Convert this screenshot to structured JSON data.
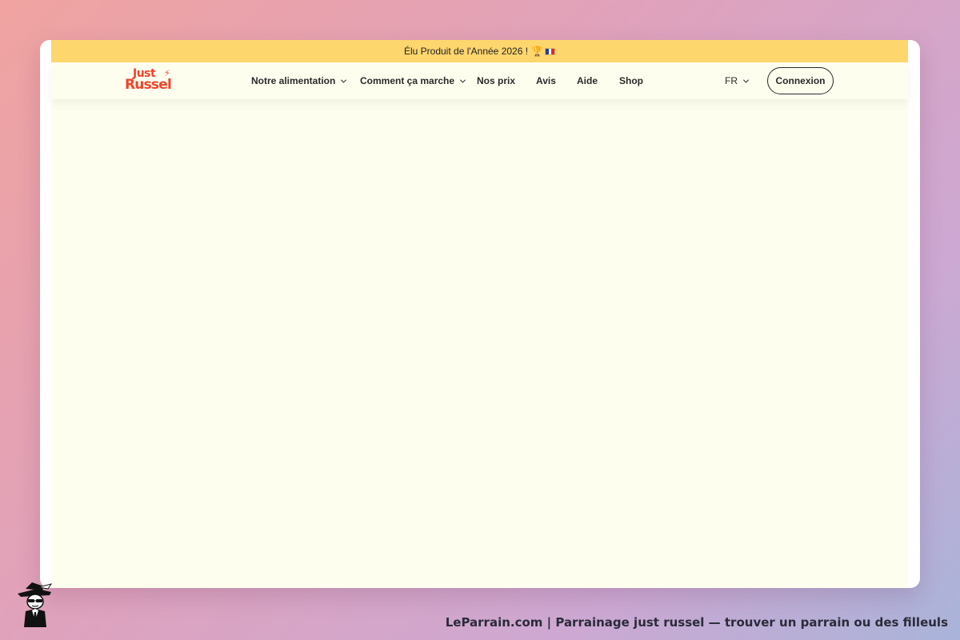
{
  "promo": {
    "text": "Élu Produit de l'Année 2026 !",
    "trophy_icon": "🏆",
    "flag_icon": "france-flag-icon"
  },
  "header": {
    "logo": {
      "line1": "Just",
      "line2": "Russel",
      "bolt_icon": "⚡",
      "color": "#f2432a"
    },
    "nav": [
      {
        "label": "Notre alimentation",
        "has_dropdown": true
      },
      {
        "label": "Comment ça marche",
        "has_dropdown": true
      },
      {
        "label": "Nos prix",
        "has_dropdown": false
      },
      {
        "label": "Avis",
        "has_dropdown": false
      },
      {
        "label": "Aide",
        "has_dropdown": false
      },
      {
        "label": "Shop",
        "has_dropdown": false
      }
    ],
    "language": {
      "selected": "FR"
    },
    "login_label": "Connexion"
  },
  "footer": {
    "caption": "LeParrain.com | Parrainage just russel — trouver un parrain ou des filleuls",
    "mascot_icon": "detective-mascot-icon"
  },
  "colors": {
    "promo_bg": "#fed66e",
    "page_bg": "#fefeef",
    "accent": "#f2432a"
  }
}
